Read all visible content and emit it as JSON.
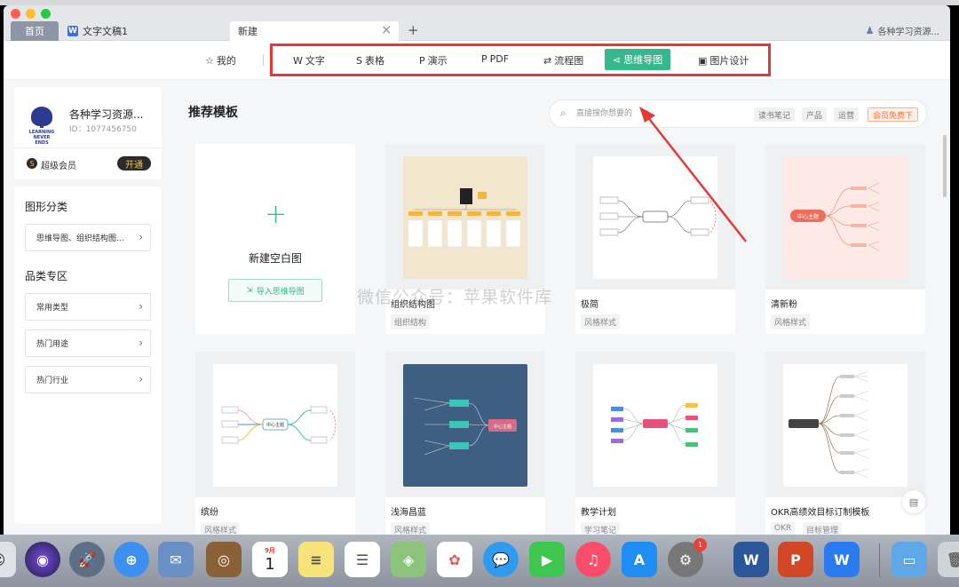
{
  "tabs": {
    "home": "首页",
    "doc": "文字文稿1",
    "doc_icon": "W",
    "new": "新建",
    "close": "×",
    "plus": "+",
    "user": "各种学习资源..."
  },
  "toolbar": {
    "mine": "我的",
    "items": [
      {
        "label": "文字",
        "icon": "W"
      },
      {
        "label": "表格",
        "icon": "S"
      },
      {
        "label": "演示",
        "icon": "P"
      },
      {
        "label": "PDF",
        "icon": "P"
      },
      {
        "label": "流程图",
        "icon": "⇄"
      },
      {
        "label": "思维导图",
        "icon": "⋖"
      },
      {
        "label": "图片设计",
        "icon": "▣"
      }
    ],
    "active_index": 5
  },
  "profile": {
    "logo_text": "LEARNING NEVER ENDS",
    "name": "各种学习资源...",
    "id": "ID：1077456750",
    "vip_label": "超级会员",
    "vip_button": "开通"
  },
  "sidebar": {
    "section1": "图形分类",
    "cat1": "思维导图、组织结构图...",
    "section2": "品类专区",
    "items": [
      "常用类型",
      "热门用途",
      "热门行业"
    ]
  },
  "content": {
    "title": "推荐模板",
    "search_placeholder": "直接搜你想要的",
    "chips": [
      "读书笔记",
      "产品",
      "运营",
      "会员免费下"
    ],
    "new_card_label": "新建空白图",
    "import_label": "导入思维导图"
  },
  "cards": [
    {
      "name": "组织结构图",
      "tag": "组织结构"
    },
    {
      "name": "极简",
      "tag": "风格样式"
    },
    {
      "name": "清新粉",
      "tag": "风格样式",
      "center": "中心主题"
    },
    {
      "name": "缤纷",
      "tag": "风格样式",
      "center": "中心主题"
    },
    {
      "name": "浅海昌蓝",
      "tag": "风格样式",
      "center": "中心主题"
    },
    {
      "name": "教学计划",
      "tag": "学习笔记"
    },
    {
      "name": "OKR高绩效目标订制模板",
      "tag": "OKR",
      "tag2": "目标管理"
    }
  ],
  "watermark": "微信公众号：苹果软件库",
  "dock": {
    "calendar_month": "9月",
    "calendar_day": "1",
    "badge": "1"
  },
  "colors": {
    "accent": "#35b88b",
    "highlight_box": "#e53935",
    "vip_gold": "#f5c24a"
  }
}
